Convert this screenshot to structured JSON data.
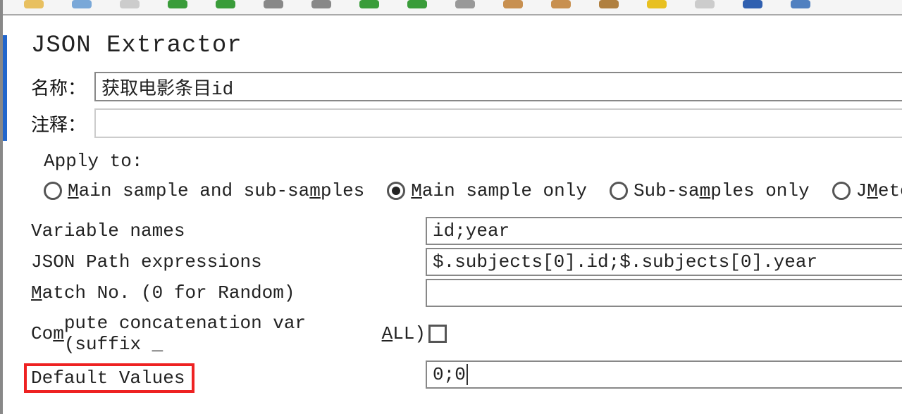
{
  "title": "JSON Extractor",
  "name": {
    "label": "名称：",
    "value": "获取电影条目id"
  },
  "comment": {
    "label": "注释："
  },
  "applyTo": {
    "label": "Apply to:",
    "options": [
      {
        "text": "Main sample and sub-samples",
        "selected": false
      },
      {
        "text": "Main sample only",
        "selected": true
      },
      {
        "text": "Sub-samples only",
        "selected": false
      },
      {
        "text": "JMeter Variabl",
        "selected": false
      }
    ]
  },
  "fields": {
    "variableNames": {
      "label": "Variable names",
      "value": "id;year"
    },
    "jsonPath": {
      "label": "JSON Path expressions",
      "value": "$.subjects[0].id;$.subjects[0].year"
    },
    "matchNo": {
      "label": "Match No. (0 for Random)",
      "value": ""
    },
    "computeConcat": {
      "label": "Compute concatenation var (suffix _ALL)",
      "checked": false
    },
    "defaultVals": {
      "label": "Default Values",
      "value": "0;0"
    }
  }
}
